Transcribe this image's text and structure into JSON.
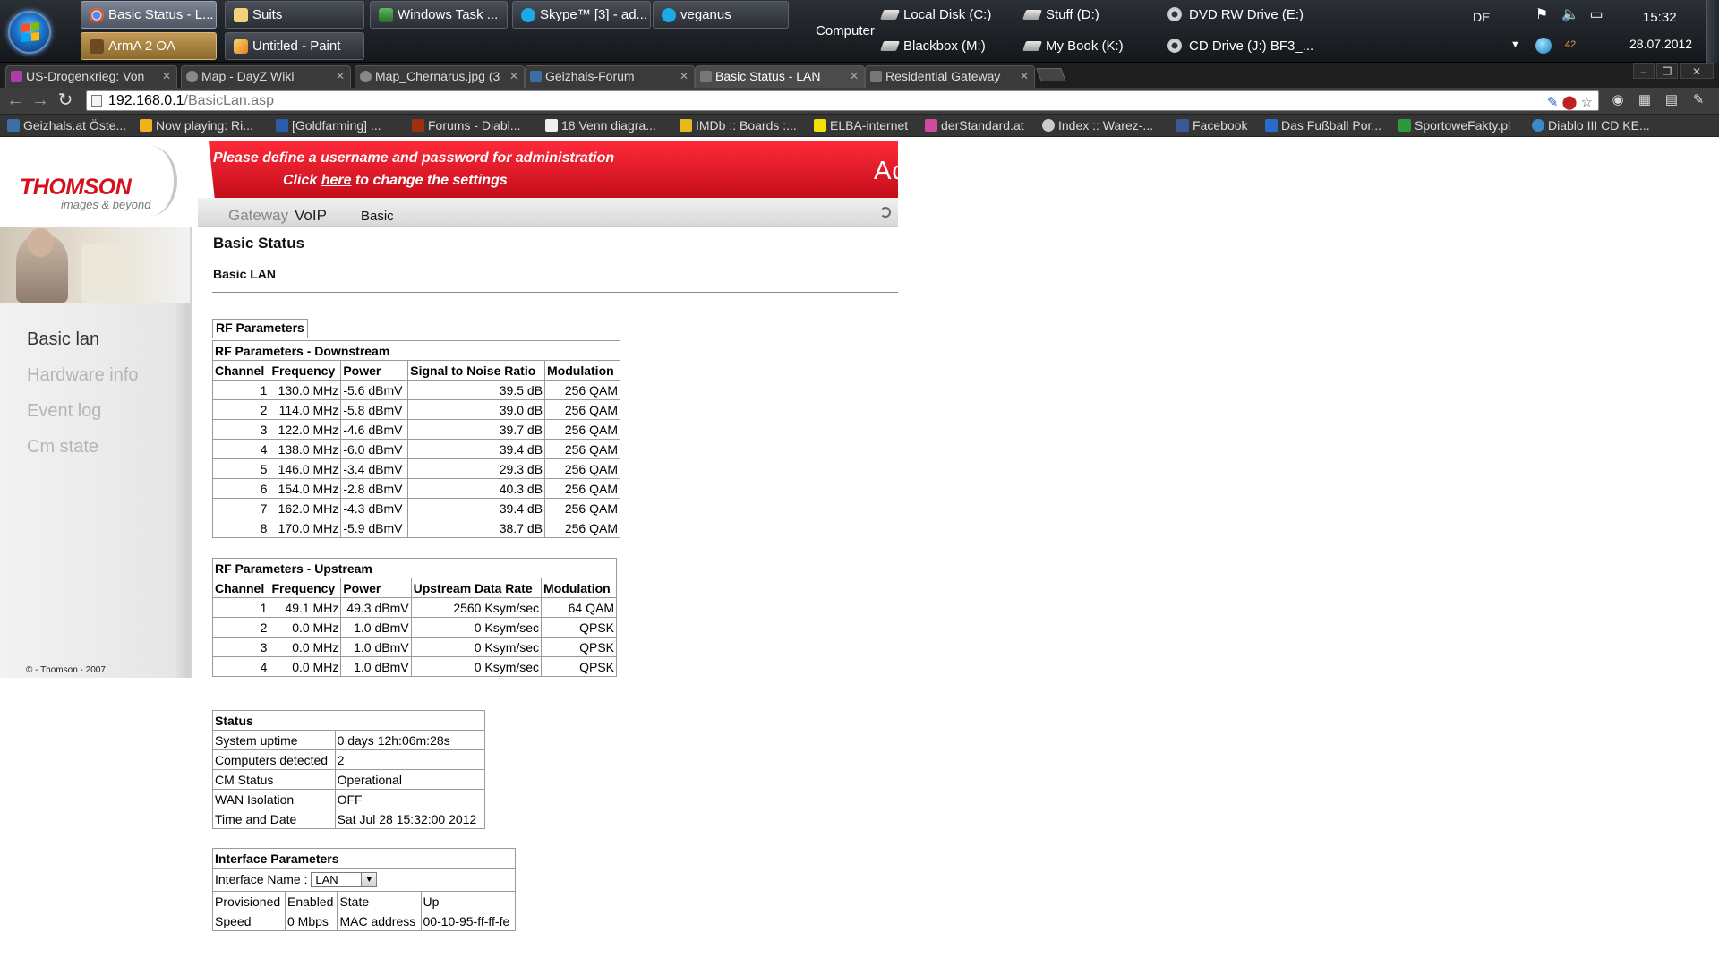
{
  "taskbar": {
    "buttons": [
      {
        "label": "Basic Status - L..."
      },
      {
        "label": "Suits"
      },
      {
        "label": "Windows Task ..."
      },
      {
        "label": "Skype™ [3] - ad..."
      },
      {
        "label": "veganus"
      },
      {
        "label": "ArmA 2 OA"
      },
      {
        "label": "Untitled - Paint"
      }
    ],
    "computer_label": "Computer",
    "drives": [
      {
        "label": "Local Disk (C:)"
      },
      {
        "label": "Stuff (D:)"
      },
      {
        "label": "DVD RW Drive (E:)"
      },
      {
        "label": "Blackbox (M:)"
      },
      {
        "label": "My Book (K:)"
      },
      {
        "label": "CD Drive (J:) BF3_..."
      }
    ],
    "language": "DE",
    "tray_badge": "42",
    "time": "15:32",
    "date": "28.07.2012"
  },
  "browser": {
    "tabs": [
      {
        "label": "US-Drogenkrieg: Von",
        "active": false
      },
      {
        "label": "Map - DayZ Wiki",
        "active": false
      },
      {
        "label": "Map_Chernarus.jpg (3",
        "active": false
      },
      {
        "label": "Geizhals-Forum",
        "active": false
      },
      {
        "label": "Basic Status - LAN",
        "active": true
      },
      {
        "label": "Residential Gateway",
        "active": false
      }
    ],
    "url_host": "192.168.0.1",
    "url_path": "/BasicLan.asp",
    "bookmarks": [
      "Geizhals.at Öste...",
      "Now playing: Ri...",
      "[Goldfarming] ...",
      "Forums - Diabl...",
      "18 Venn diagra...",
      "IMDb :: Boards :...",
      "ELBA-internet",
      "derStandard.at",
      "Index :: Warez-...",
      "Facebook",
      "Das Fußball Por...",
      "SportoweFakty.pl",
      "Diablo III CD KE..."
    ]
  },
  "router": {
    "logo": "THOMSON",
    "logo_tagline": "images & beyond",
    "notice_line1": "Please define a username and password for administration",
    "notice_click": "Click",
    "notice_link": "here",
    "notice_rest": "to change the settings",
    "admin_title": "Administration",
    "nav": {
      "gateway": "Gateway",
      "voip": "VoIP",
      "basic": "Basic"
    },
    "sidebar": [
      {
        "label": "Basic lan"
      },
      {
        "label": "Hardware info"
      },
      {
        "label": "Event log"
      },
      {
        "label": "Cm state"
      }
    ],
    "copyright": "© - Thomson - 2007",
    "page_title": "Basic Status",
    "section_title": "Basic LAN",
    "rf_header": "RF Parameters",
    "downstream": {
      "title": "RF Parameters - Downstream",
      "columns": [
        "Channel",
        "Frequency",
        "Power",
        "Signal to Noise Ratio",
        "Modulation"
      ],
      "rows": [
        [
          "1",
          "130.0 MHz",
          "-5.6 dBmV",
          "39.5 dB",
          "256 QAM"
        ],
        [
          "2",
          "114.0 MHz",
          "-5.8 dBmV",
          "39.0 dB",
          "256 QAM"
        ],
        [
          "3",
          "122.0 MHz",
          "-4.6 dBmV",
          "39.7 dB",
          "256 QAM"
        ],
        [
          "4",
          "138.0 MHz",
          "-6.0 dBmV",
          "39.4 dB",
          "256 QAM"
        ],
        [
          "5",
          "146.0 MHz",
          "-3.4 dBmV",
          "29.3 dB",
          "256 QAM"
        ],
        [
          "6",
          "154.0 MHz",
          "-2.8 dBmV",
          "40.3 dB",
          "256 QAM"
        ],
        [
          "7",
          "162.0 MHz",
          "-4.3 dBmV",
          "39.4 dB",
          "256 QAM"
        ],
        [
          "8",
          "170.0 MHz",
          "-5.9 dBmV",
          "38.7 dB",
          "256 QAM"
        ]
      ]
    },
    "upstream": {
      "title": "RF Parameters - Upstream",
      "columns": [
        "Channel",
        "Frequency",
        "Power",
        "Upstream Data Rate",
        "Modulation"
      ],
      "rows": [
        [
          "1",
          "49.1 MHz",
          "49.3 dBmV",
          "2560 Ksym/sec",
          "64 QAM"
        ],
        [
          "2",
          "0.0 MHz",
          "1.0 dBmV",
          "0 Ksym/sec",
          "QPSK"
        ],
        [
          "3",
          "0.0 MHz",
          "1.0 dBmV",
          "0 Ksym/sec",
          "QPSK"
        ],
        [
          "4",
          "0.0 MHz",
          "1.0 dBmV",
          "0 Ksym/sec",
          "QPSK"
        ]
      ]
    },
    "status": {
      "title": "Status",
      "rows": [
        [
          "System uptime",
          "0 days 12h:06m:28s"
        ],
        [
          "Computers detected",
          "2"
        ],
        [
          "CM Status",
          "Operational"
        ],
        [
          "WAN Isolation",
          "OFF"
        ],
        [
          "Time and Date",
          "Sat Jul 28 15:32:00 2012"
        ]
      ]
    },
    "interface": {
      "title": "Interface Parameters",
      "name_label": "Interface Name :",
      "name_value": "LAN",
      "row1": [
        "Provisioned",
        "Enabled",
        "State",
        "Up"
      ],
      "row2": [
        "Speed",
        "0 Mbps",
        "MAC address",
        "00-10-95-ff-ff-fe"
      ]
    }
  },
  "colors": {
    "banner_red": "#e01a26",
    "logo_red": "#d4121c",
    "sidebar_gray": "#eeeeee"
  }
}
